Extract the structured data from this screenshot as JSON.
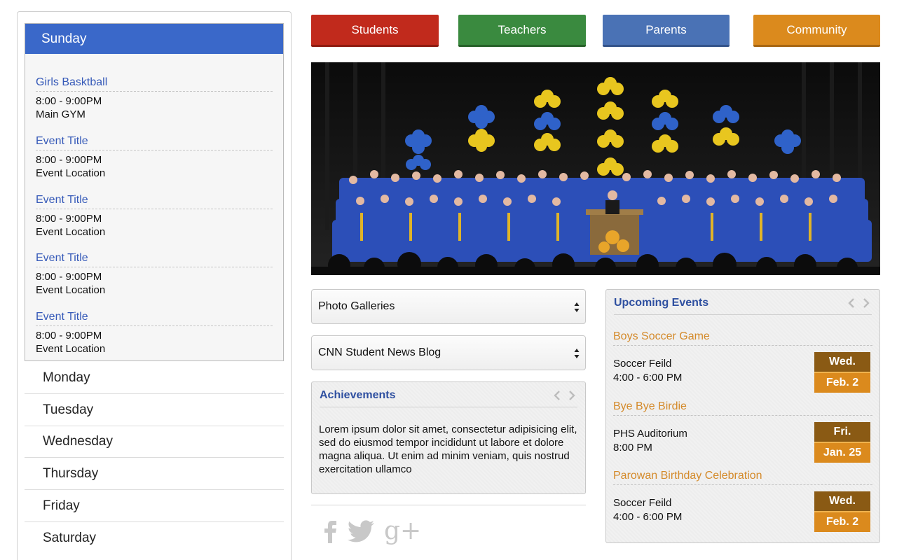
{
  "calendar": {
    "active_day": "Sunday",
    "events": [
      {
        "title": "Girls Basktball",
        "time": "8:00 - 9:00PM",
        "location": "Main GYM"
      },
      {
        "title": "Event Title",
        "time": "8:00 - 9:00PM",
        "location": "Event Location"
      },
      {
        "title": "Event Title",
        "time": "8:00 - 9:00PM",
        "location": "Event Location"
      },
      {
        "title": "Event Title",
        "time": "8:00 - 9:00PM",
        "location": "Event Location"
      },
      {
        "title": "Event Title",
        "time": "8:00 - 9:00PM",
        "location": "Event Location"
      }
    ],
    "days": [
      "Monday",
      "Tuesday",
      "Wednesday",
      "Thursday",
      "Friday",
      "Saturday"
    ]
  },
  "nav": {
    "students": "Students",
    "teachers": "Teachers",
    "parents": "Parents",
    "community": "Community"
  },
  "hero": {
    "icon": "graduation-photo"
  },
  "selects": {
    "galleries": "Photo Galleries",
    "blog": "CNN Student News Blog"
  },
  "achievements": {
    "title": "Achievements",
    "text": "Lorem ipsum dolor sit amet, consectetur adipisicing elit, sed do eiusmod tempor incididunt ut labore et dolore magna aliqua. Ut enim ad minim veniam, quis nostrud exercitation ullamco"
  },
  "social": {
    "icons": [
      "facebook-icon",
      "twitter-icon",
      "google-plus-icon"
    ],
    "google_plus_glyph": "g+"
  },
  "upcoming": {
    "title": "Upcoming Events",
    "events": [
      {
        "title": "Boys Soccer Game",
        "location": "Soccer Feild",
        "time": "4:00 - 6:00 PM",
        "day": "Wed.",
        "date": "Feb. 2"
      },
      {
        "title": "Bye Bye Birdie",
        "location": "PHS Auditorium",
        "time": "8:00 PM",
        "day": "Fri.",
        "date": "Jan. 25"
      },
      {
        "title": "Parowan Birthday Celebration",
        "location": "Soccer Feild",
        "time": "4:00 - 6:00 PM",
        "day": "Wed.",
        "date": "Feb. 2"
      }
    ]
  },
  "colors": {
    "students": "#c12a1c",
    "teachers": "#3a8a3f",
    "parents": "#4a72b5",
    "community": "#db8a1d",
    "calendar_header": "#3a68c9",
    "link_blue": "#3559b8",
    "event_orange": "#d48a2a"
  }
}
